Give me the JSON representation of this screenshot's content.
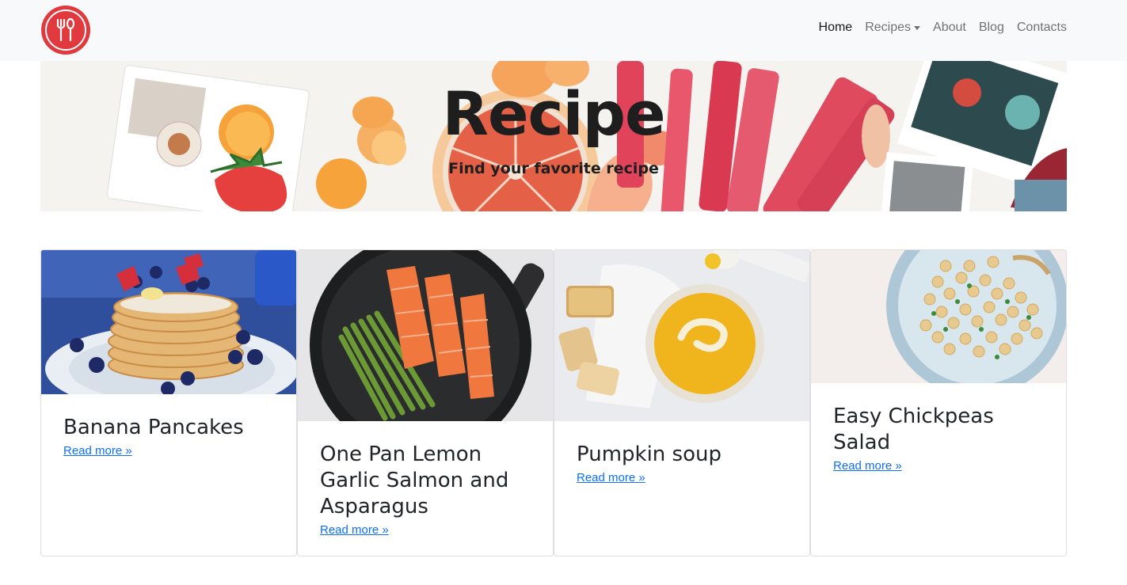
{
  "nav": {
    "brand_logo": "utensils-logo-icon",
    "brand_color": "#e0393e",
    "items": [
      {
        "label": "Home",
        "active": true
      },
      {
        "label": "Recipes",
        "dropdown": true
      },
      {
        "label": "About"
      },
      {
        "label": "Blog"
      },
      {
        "label": "Contacts"
      }
    ]
  },
  "hero": {
    "title": "Recipe",
    "subtitle": "Find your favorite recipe"
  },
  "cards": [
    {
      "title": "Banana Pancakes",
      "link": "Read more »",
      "image": "pancakes-photo"
    },
    {
      "title": "One Pan Lemon Garlic Salmon and Asparagus",
      "link": "Read more »",
      "image": "salmon-asparagus-photo"
    },
    {
      "title": "Pumpkin soup",
      "link": "Read more »",
      "image": "pumpkin-soup-photo"
    },
    {
      "title": "Easy Chickpeas Salad",
      "link": "Read more »",
      "image": "chickpeas-salad-photo"
    }
  ],
  "colors": {
    "link": "#0d6efd",
    "navbar_bg": "#f8f9fa"
  }
}
